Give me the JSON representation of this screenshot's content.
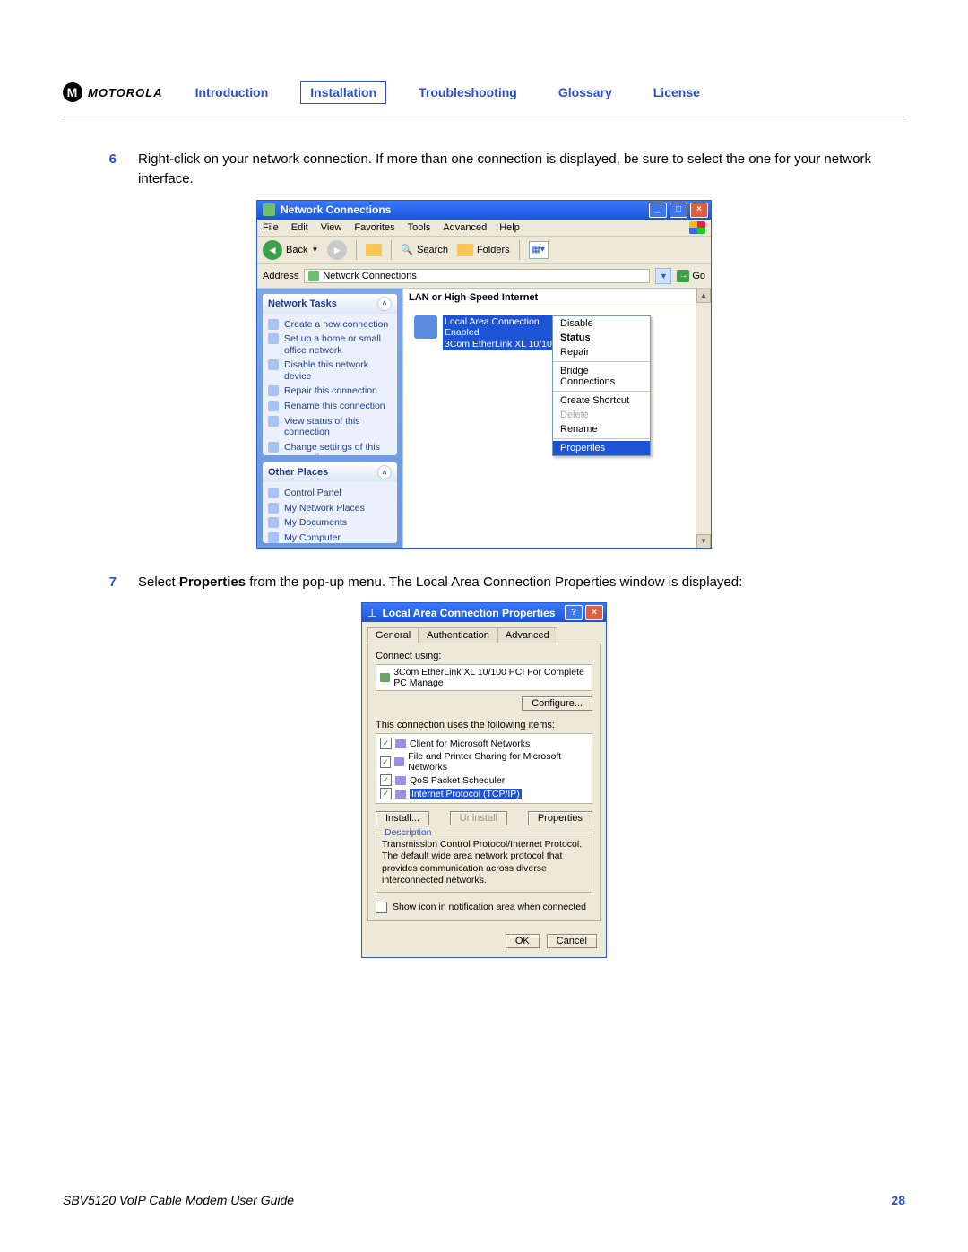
{
  "header": {
    "brand": "MOTOROLA",
    "logo_letter": "M",
    "nav": {
      "introduction": "Introduction",
      "installation": "Installation",
      "troubleshooting": "Troubleshooting",
      "glossary": "Glossary",
      "license": "License"
    }
  },
  "steps": {
    "s6": {
      "num": "6",
      "text": "Right-click on your network connection. If more than one connection is displayed, be sure to select the one for your network interface."
    },
    "s7": {
      "num": "7",
      "pre": "Select ",
      "bold": "Properties",
      "post": " from the pop-up menu. The Local Area Connection Properties window is displayed:"
    }
  },
  "fig1": {
    "title": "Network Connections",
    "menubar": [
      "File",
      "Edit",
      "View",
      "Favorites",
      "Tools",
      "Advanced",
      "Help"
    ],
    "toolbar": {
      "back": "Back",
      "search": "Search",
      "folders": "Folders"
    },
    "address_label": "Address",
    "address_value": "Network Connections",
    "go": "Go",
    "main_heading": "LAN or High-Speed Internet",
    "conn": {
      "name": "Local Area Connection",
      "status": "Enabled",
      "device": "3Com EtherLink XL 10/100 P…"
    },
    "context_menu": [
      "Disable",
      "Status",
      "Repair",
      "__sep__",
      "Bridge Connections",
      "__sep__",
      "Create Shortcut",
      "Delete",
      "Rename",
      "__sep__",
      "Properties"
    ],
    "context_disabled": [
      "Delete"
    ],
    "context_bold": [
      "Status"
    ],
    "context_selected": "Properties",
    "sidebar": {
      "network_tasks": {
        "title": "Network Tasks",
        "items": [
          "Create a new connection",
          "Set up a home or small office network",
          "Disable this network device",
          "Repair this connection",
          "Rename this connection",
          "View status of this connection",
          "Change settings of this connection"
        ]
      },
      "other_places": {
        "title": "Other Places",
        "items": [
          "Control Panel",
          "My Network Places",
          "My Documents",
          "My Computer"
        ]
      }
    }
  },
  "fig2": {
    "title": "Local Area Connection Properties",
    "tabs": [
      "General",
      "Authentication",
      "Advanced"
    ],
    "connect_using_label": "Connect using:",
    "adapter": "3Com EtherLink XL 10/100 PCI For Complete PC Manage",
    "configure": "Configure...",
    "items_label": "This connection uses the following items:",
    "items": [
      "Client for Microsoft Networks",
      "File and Printer Sharing for Microsoft Networks",
      "QoS Packet Scheduler",
      "Internet Protocol (TCP/IP)"
    ],
    "selected_item": "Internet Protocol (TCP/IP)",
    "install": "Install...",
    "uninstall": "Uninstall",
    "properties": "Properties",
    "description_label": "Description",
    "description_text": "Transmission Control Protocol/Internet Protocol. The default wide area network protocol that provides communication across diverse interconnected networks.",
    "show_icon": "Show icon in notification area when connected",
    "ok": "OK",
    "cancel": "Cancel"
  },
  "footer": {
    "title": "SBV5120 VoIP Cable Modem User Guide",
    "page": "28"
  }
}
